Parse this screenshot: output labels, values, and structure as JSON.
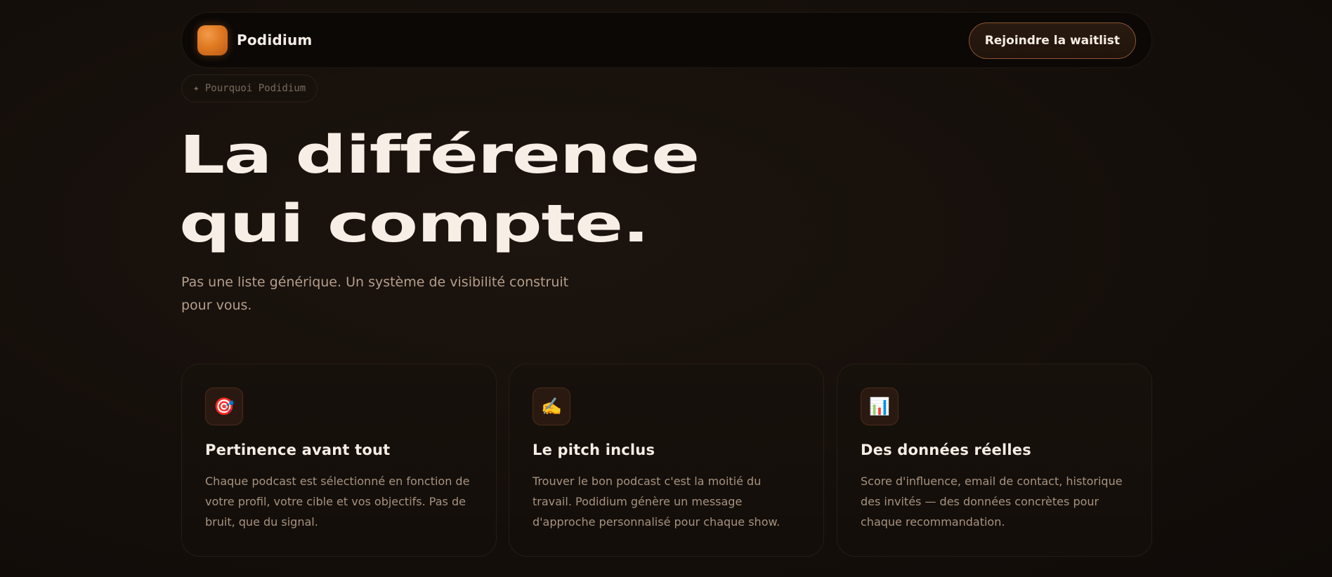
{
  "nav": {
    "brand": "Podidium",
    "cta_label": "Rejoindre la waitlist"
  },
  "badge": {
    "icon": "sparkle-icon",
    "label": "✦ Pourquoi Podidium"
  },
  "hero": {
    "title_line1": "La différence",
    "title_line2": "qui compte.",
    "subtitle": "Pas une liste générique. Un système de visibilité construit pour vous."
  },
  "features": [
    {
      "icon": "target-icon",
      "glyph": "🎯",
      "title": "Pertinence avant tout",
      "text": "Chaque podcast est sélectionné en fonction de votre profil, votre cible et vos objectifs. Pas de bruit, que du signal."
    },
    {
      "icon": "writing-hand-icon",
      "glyph": "✍️",
      "title": "Le pitch inclus",
      "text": "Trouver le bon podcast c'est la moitié du travail. Podidium génère un message d'approche personnalisé pour chaque show."
    },
    {
      "icon": "bar-chart-icon",
      "glyph": "📊",
      "title": "Des données réelles",
      "text": "Score d'influence, email de contact, historique des invités — des données concrètes pour chaque recommandation."
    }
  ],
  "colors": {
    "accent": "#e07a22",
    "background": "#150f0b",
    "text": "#f6ede4",
    "muted": "#a8927f"
  }
}
